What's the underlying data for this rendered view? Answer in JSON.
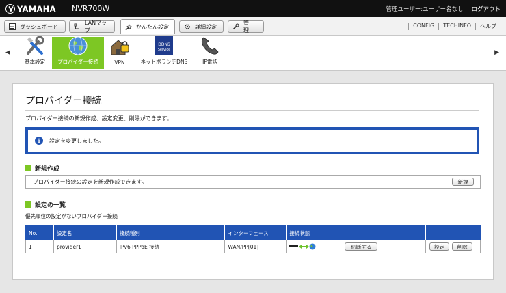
{
  "header": {
    "brand": "YAMAHA",
    "model": "NVR700W",
    "user_label": "管理ユーザー:ユーザー名なし",
    "logout": "ログアウト"
  },
  "menu": {
    "tabs": [
      {
        "label": "ダッシュボード",
        "icon": "dashboard-icon"
      },
      {
        "label": "LANマップ",
        "icon": "lan-map-icon"
      },
      {
        "label": "かんたん設定",
        "icon": "wizard-icon",
        "active": true
      },
      {
        "label": "詳細設定",
        "icon": "gear-icon"
      },
      {
        "label": "管　理",
        "icon": "wrench-icon"
      }
    ],
    "links": [
      "CONFIG",
      "TECHINFO",
      "ヘルプ"
    ]
  },
  "toolbar": {
    "left_arrow": "◀",
    "right_arrow": "▶",
    "items": [
      {
        "label": "基本設定",
        "icon": "tools-icon"
      },
      {
        "label": "プロバイダー接続",
        "icon": "globe-icon",
        "active": true
      },
      {
        "label": "VPN",
        "icon": "vpn-house-icon"
      },
      {
        "label": "ネットボランチDNS",
        "icon": "ddns-icon",
        "badge": "DDNS\nService"
      },
      {
        "label": "IP電話",
        "icon": "phone-icon"
      }
    ]
  },
  "page": {
    "title": "プロバイダー接続",
    "description": "プロバイダー接続の新規作成、設定変更、削除ができます。",
    "notice": "設定を変更しました。",
    "new_section": {
      "title": "新規作成",
      "text": "プロバイダー接続の設定を新規作成できます。",
      "button": "新規"
    },
    "list_section": {
      "title": "設定の一覧",
      "subtitle": "優先順位の設定がないプロバイダー接続"
    },
    "table": {
      "headers": [
        "No.",
        "設定名",
        "接続種別",
        "インターフェース",
        "接続状態",
        ""
      ],
      "rows": [
        {
          "no": "1",
          "name": "provider1",
          "type": "IPv6 PPPoE 接続",
          "interface": "WAN/PP[01]",
          "switch_button": "切断する",
          "edit_button": "設定",
          "delete_button": "削除"
        }
      ]
    }
  },
  "colors": {
    "accent_green": "#7dc724",
    "accent_blue": "#2154b4",
    "topbar": "#111111"
  }
}
